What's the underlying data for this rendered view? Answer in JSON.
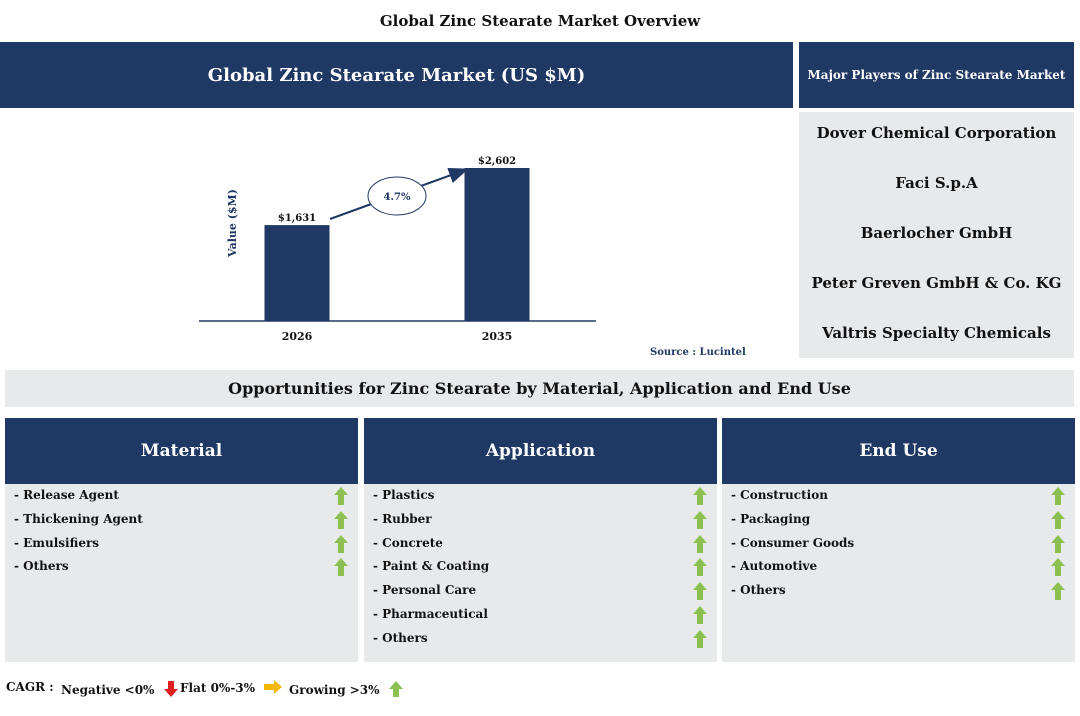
{
  "page_title": "Global Zinc Stearate Market Overview",
  "chart_header": "Global Zinc Stearate Market (US $M)",
  "chart_data": {
    "type": "bar",
    "categories": [
      "2026",
      "2035"
    ],
    "values": [
      1631,
      2602
    ],
    "value_labels": [
      "$1,631",
      "$2,602"
    ],
    "ylabel": "Value ($M)",
    "xlabel": "",
    "ylim": [
      0,
      2602
    ],
    "cagr_label": "4.7%",
    "bar_color": "#203864",
    "grid": false
  },
  "source": "Source : Lucintel",
  "players": {
    "title": "Major Players of Zinc Stearate Market",
    "items": [
      "Dover Chemical Corporation",
      "Faci S.p.A",
      "Baerlocher GmbH",
      "Peter Greven GmbH & Co. KG",
      "Valtris Specialty Chemicals"
    ]
  },
  "opportunities_title": "Opportunities for Zinc Stearate by Material, Application and End Use",
  "columns": [
    {
      "title": "Material",
      "items": [
        "- Release Agent",
        "- Thickening Agent",
        "- Emulsifiers",
        "- Others"
      ]
    },
    {
      "title": "Application",
      "items": [
        "- Plastics",
        "- Rubber",
        "- Concrete",
        "- Paint & Coating",
        "- Personal Care",
        "- Pharmaceutical",
        "- Others"
      ]
    },
    {
      "title": "End Use",
      "items": [
        "- Construction",
        "- Packaging",
        "- Consumer Goods",
        "- Automotive",
        "- Others"
      ]
    }
  ],
  "legend": {
    "label": "CAGR :",
    "negative": "Negative <0%",
    "flat": "Flat 0%-3%",
    "growing": "Growing >3%"
  },
  "colors": {
    "navy": "#203864",
    "grey_panel": "#e8e9eb",
    "green_arrow": "#8cc152",
    "red_arrow": "#e02020",
    "yellow_arrow": "#f5b800"
  }
}
